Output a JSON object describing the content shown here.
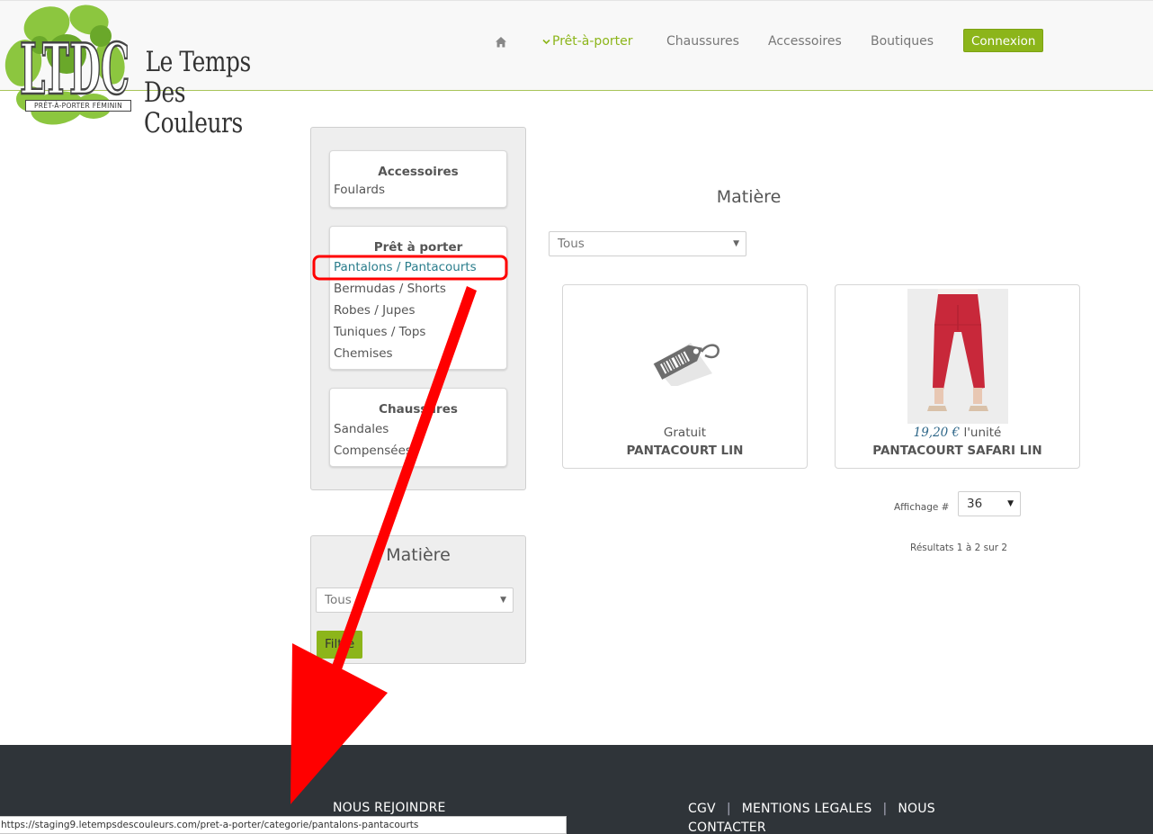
{
  "logo": {
    "name_line1": "Le Temps",
    "name_line2": "Des Couleurs",
    "monogram": "LTDC",
    "tagline": "PRÊT-À-PORTER FÉMININ"
  },
  "nav": {
    "items": [
      {
        "label": "Prêt-à-porter",
        "active": true
      },
      {
        "label": "Chaussures",
        "active": false
      },
      {
        "label": "Accessoires",
        "active": false
      },
      {
        "label": "Boutiques",
        "active": false
      }
    ],
    "login_label": "Connexion"
  },
  "sidebar": {
    "categories": [
      {
        "title": "Accessoires",
        "links": [
          "Foulards"
        ]
      },
      {
        "title": "Prêt à porter",
        "links": [
          "Pantalons / Pantacourts",
          "Bermudas / Shorts",
          "Robes / Jupes",
          "Tuniques / Tops",
          "Chemises"
        ]
      },
      {
        "title": "Chaussures",
        "links": [
          "Sandales",
          "Compensées"
        ]
      }
    ],
    "filter": {
      "title": "Matière",
      "select_value": "Tous",
      "button_label": "Filtre"
    }
  },
  "main": {
    "filter_title": "Matière",
    "filter_value": "Tous",
    "products": [
      {
        "price": "Gratuit",
        "name": "PANTACOURT LIN"
      },
      {
        "price": "19,20 €",
        "unit": "l'unité",
        "name": "PANTACOURT SAFARI LIN"
      }
    ],
    "display_label": "Affichage #",
    "display_value": "36",
    "results": "Résultats 1 à 2 sur 2"
  },
  "footer": {
    "join": "NOUS REJOINDRE",
    "links": [
      "CGV",
      "MENTIONS LEGALES",
      "NOUS CONTACTER"
    ],
    "separator": "|"
  },
  "status_url": "https://staging9.letempsdescouleurs.com/pret-a-porter/categorie/pantalons-pantacourts",
  "colors": {
    "accent": "#8cb51a",
    "link_selected": "#2a7d8c",
    "footer_bg": "#2f3439",
    "annotation": "#ff0000"
  }
}
